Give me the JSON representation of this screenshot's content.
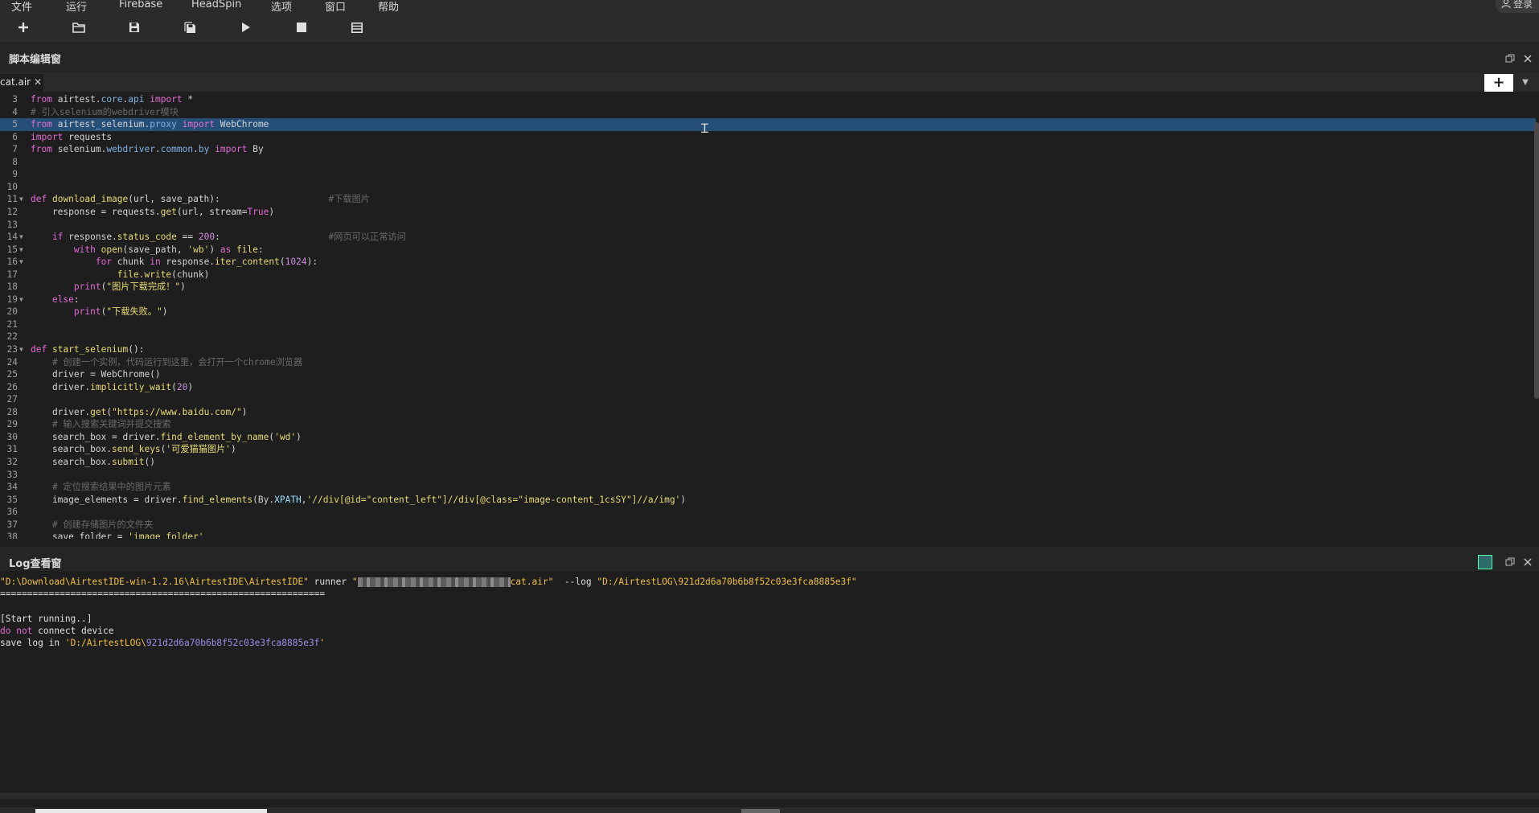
{
  "menu": [
    "文件",
    "运行",
    "Firebase",
    "HeadSpin",
    "选项",
    "窗口",
    "帮助"
  ],
  "login_label": "登录",
  "editor_panel": {
    "title": "脚本编辑窗"
  },
  "tab": {
    "label": "cat.air",
    "close": "✕"
  },
  "add_tab": "+",
  "code_lines": [
    {
      "n": "3",
      "fold": false,
      "html": "<span class=\"kw\">from</span> airtest.<span class=\"mod\">core</span>.<span class=\"mod\">api</span> <span class=\"kw\">import</span> *"
    },
    {
      "n": "4",
      "fold": false,
      "html": "<span class=\"cm\"># 引入selenium的webdriver模块</span>"
    },
    {
      "n": "5",
      "fold": false,
      "hl": true,
      "html": "<span class=\"kw\">from</span> airtest_selenium.<span class=\"mod\">proxy</span> <span class=\"kw\">import</span> WebChrome"
    },
    {
      "n": "6",
      "fold": false,
      "html": "<span class=\"kw\">import</span> requests"
    },
    {
      "n": "7",
      "fold": false,
      "html": "<span class=\"kw\">from</span> selenium.<span class=\"mod\">webdriver</span>.<span class=\"mod\">common</span>.<span class=\"mod\">by</span> <span class=\"kw\">import</span> By"
    },
    {
      "n": "8",
      "fold": false,
      "html": ""
    },
    {
      "n": "9",
      "fold": false,
      "html": ""
    },
    {
      "n": "10",
      "fold": false,
      "html": ""
    },
    {
      "n": "11",
      "fold": true,
      "html": "<span class=\"kw\">def</span> <span class=\"fn\">download_image</span>(url, save_path):                    <span class=\"cm\">#下载图片</span>"
    },
    {
      "n": "12",
      "fold": false,
      "html": "    response = requests.<span class=\"fn\">get</span>(url, stream=<span class=\"tru\">True</span>)"
    },
    {
      "n": "13",
      "fold": false,
      "html": ""
    },
    {
      "n": "14",
      "fold": true,
      "html": "    <span class=\"kw\">if</span> response.<span class=\"fn\">status_code</span> == <span class=\"num\">200</span>:                    <span class=\"cm\">#网页可以正常访问</span>"
    },
    {
      "n": "15",
      "fold": true,
      "html": "        <span class=\"kw\">with</span> <span class=\"fn\">open</span>(save_path, <span class=\"str\">'wb'</span>) <span class=\"kw\">as</span> <span class=\"fn\">file</span>:"
    },
    {
      "n": "16",
      "fold": true,
      "html": "            <span class=\"kw\">for</span> chunk <span class=\"kw\">in</span> response.<span class=\"fn\">iter_content</span>(<span class=\"num\">1024</span>):"
    },
    {
      "n": "17",
      "fold": false,
      "html": "                <span class=\"fn\">file</span>.<span class=\"fn\">write</span>(chunk)"
    },
    {
      "n": "18",
      "fold": false,
      "html": "        <span class=\"kw\">print</span>(<span class=\"str\">\"图片下载完成！\"</span>)"
    },
    {
      "n": "19",
      "fold": true,
      "html": "    <span class=\"kw\">else</span>:"
    },
    {
      "n": "20",
      "fold": false,
      "html": "        <span class=\"kw\">print</span>(<span class=\"str\">\"下载失败。\"</span>)"
    },
    {
      "n": "21",
      "fold": false,
      "html": ""
    },
    {
      "n": "22",
      "fold": false,
      "html": ""
    },
    {
      "n": "23",
      "fold": true,
      "html": "<span class=\"kw\">def</span> <span class=\"fn\">start_selenium</span>():"
    },
    {
      "n": "24",
      "fold": false,
      "html": "    <span class=\"cm\"># 创建一个实例，代码运行到这里，会打开一个chrome浏览器</span>"
    },
    {
      "n": "25",
      "fold": false,
      "html": "    driver = WebChrome()"
    },
    {
      "n": "26",
      "fold": false,
      "html": "    driver.<span class=\"fn\">implicitly_wait</span>(<span class=\"num\">20</span>)"
    },
    {
      "n": "27",
      "fold": false,
      "html": ""
    },
    {
      "n": "28",
      "fold": false,
      "html": "    driver.<span class=\"fn\">get</span>(<span class=\"str\">\"https://www.baidu.com/\"</span>)"
    },
    {
      "n": "29",
      "fold": false,
      "html": "    <span class=\"cm\"># 输入搜索关键词并提交搜索</span>"
    },
    {
      "n": "30",
      "fold": false,
      "html": "    search_box = driver.<span class=\"fn\">find_element_by_name</span>(<span class=\"str\">'wd'</span>)"
    },
    {
      "n": "31",
      "fold": false,
      "html": "    search_box.<span class=\"fn\">send_keys</span>(<span class=\"str\">'可爱猫猫图片'</span>)"
    },
    {
      "n": "32",
      "fold": false,
      "html": "    search_box.<span class=\"fn\">submit</span>()"
    },
    {
      "n": "33",
      "fold": false,
      "html": ""
    },
    {
      "n": "34",
      "fold": false,
      "html": "    <span class=\"cm\"># 定位搜索结果中的图片元素</span>"
    },
    {
      "n": "35",
      "fold": false,
      "html": "    image_elements = driver.<span class=\"fn\">find_elements</span>(By.<span class=\"cls\">XPATH</span>,<span class=\"str\">'//div[@id=\"content_left\"]//div[@class=\"image-content_1csSY\"]//a/img'</span>)"
    },
    {
      "n": "36",
      "fold": false,
      "html": ""
    },
    {
      "n": "37",
      "fold": false,
      "html": "    <span class=\"cm\"># 创建存储图片的文件夹</span>"
    },
    {
      "n": "38",
      "fold": false,
      "html": "    save_folder = <span class=\"str\">'image_folder'</span>"
    }
  ],
  "log_panel": {
    "title": "Log查看窗"
  },
  "log": {
    "cmd_exe": "\"D:\\Download\\AirtestIDE-win-1.2.16\\AirtestIDE\\AirtestIDE\"",
    "cmd_runner": " runner ",
    "cmd_quote_open": "\"",
    "cmd_file": "cat.air\"",
    "cmd_log_flag": "  --log ",
    "cmd_log_path": "\"D:/AirtestLOG\\921d2d6a70b6b8f52c03e3fca8885e3f\"",
    "separator": "============================================================",
    "start": "[Start running..]",
    "do_not": "do not",
    "connect": " connect device",
    "save_prefix": "save log in ",
    "save_path_a": "'D:/AirtestLOG\\",
    "save_path_hex": "921d2d6a70b6b8f52c03e3fca8885e3f",
    "save_path_b": "'"
  }
}
